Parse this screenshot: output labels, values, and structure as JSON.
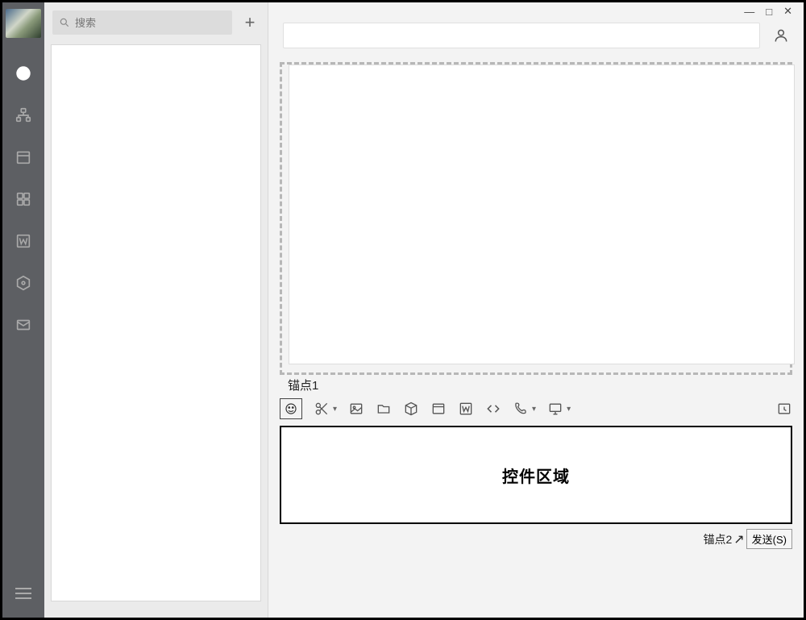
{
  "window_controls": {
    "minimize": "—",
    "maximize": "□",
    "close": "✕"
  },
  "nav": {
    "items": [
      {
        "name": "chat-circle-icon"
      },
      {
        "name": "org-chart-icon"
      },
      {
        "name": "calendar-icon"
      },
      {
        "name": "apps-grid-icon"
      },
      {
        "name": "word-icon"
      },
      {
        "name": "hexagon-icon"
      },
      {
        "name": "mail-icon"
      }
    ],
    "menu": "menu-icon"
  },
  "sidebar": {
    "search_placeholder": "搜索",
    "add_label": "+"
  },
  "header": {
    "profile_icon": "person-icon"
  },
  "anchors": {
    "anchor1": "锚点1",
    "anchor2": "锚点2"
  },
  "toolbar": {
    "emoji": "emoji-icon",
    "scissors": "scissors-icon",
    "image": "image-icon",
    "folder": "folder-icon",
    "cube": "cube-icon",
    "window": "window-icon",
    "word": "word-square-icon",
    "code": "code-icon",
    "phone": "phone-icon",
    "screen": "screen-share-icon",
    "history": "history-icon"
  },
  "compose": {
    "placeholder": "控件区域"
  },
  "send": {
    "label": "发送(S)"
  }
}
